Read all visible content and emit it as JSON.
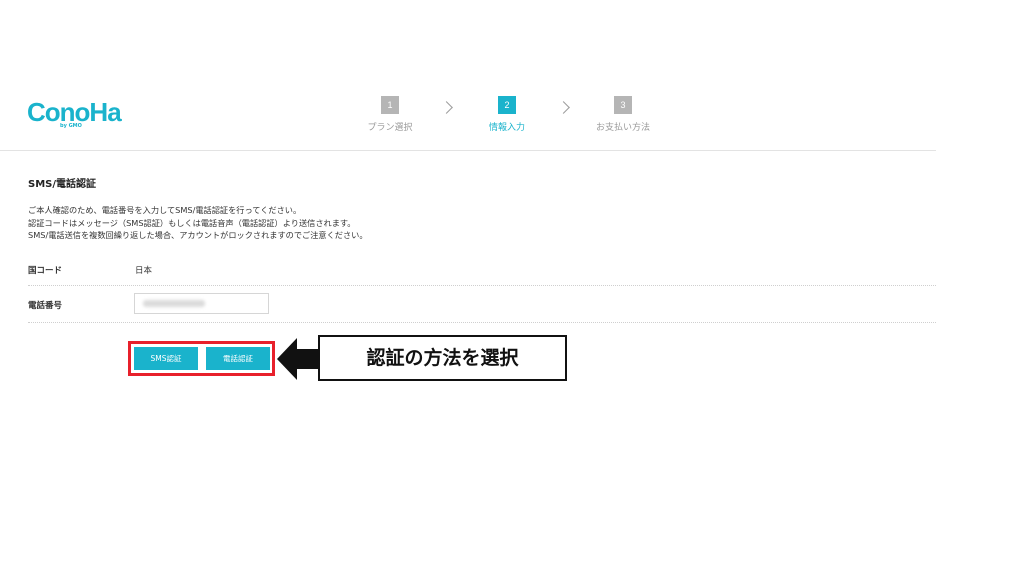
{
  "logo": {
    "brand": "ConoHa",
    "sub": "by GMO"
  },
  "steps": [
    {
      "num": "1",
      "label": "プラン選択",
      "active": false
    },
    {
      "num": "2",
      "label": "情報入力",
      "active": true
    },
    {
      "num": "3",
      "label": "お支払い方法",
      "active": false
    }
  ],
  "section": {
    "title": "SMS/電話認証",
    "description": [
      "ご本人確認のため、電話番号を入力してSMS/電話認証を行ってください。",
      "認証コードはメッセージ（SMS認証）もしくは電話音声（電話認証）より送信されます。",
      "SMS/電話送信を複数回繰り返した場合、アカウントがロックされますのでご注意ください。"
    ]
  },
  "form": {
    "country_label": "国コード",
    "country_value": "日本",
    "phone_label": "電話番号",
    "phone_value": ""
  },
  "buttons": {
    "sms": "SMS認証",
    "phone": "電話認証"
  },
  "annotation": {
    "callout": "認証の方法を選択",
    "highlight_color": "#e8202b"
  },
  "colors": {
    "accent": "#1ab3cc",
    "step_inactive": "#b5b5b5"
  }
}
